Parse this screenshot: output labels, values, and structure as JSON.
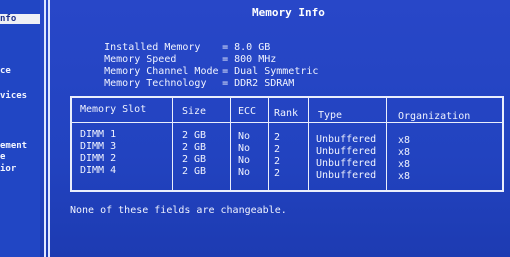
{
  "sidebar": {
    "items": [
      {
        "label": "nfo"
      },
      {
        "label": "ce"
      },
      {
        "label": "vices"
      },
      {
        "label": "ement"
      },
      {
        "label": "e"
      },
      {
        "label": "ior"
      }
    ]
  },
  "page": {
    "title": "Memory Info",
    "info": [
      {
        "label": "Installed Memory",
        "value": "8.0 GB"
      },
      {
        "label": "Memory Speed",
        "value": "800 MHz"
      },
      {
        "label": "Memory Channel Mode",
        "value": "Dual Symmetric"
      },
      {
        "label": "Memory Technology",
        "value": "DDR2 SDRAM"
      }
    ],
    "table": {
      "headers": [
        "Memory Slot",
        "Size",
        "ECC",
        "Rank",
        "Type",
        "Organization"
      ],
      "rows": [
        [
          "DIMM 1",
          "2 GB",
          "No",
          "2",
          "Unbuffered",
          "x8"
        ],
        [
          "DIMM 3",
          "2 GB",
          "No",
          "2",
          "Unbuffered",
          "x8"
        ],
        [
          "DIMM 2",
          "2 GB",
          "No",
          "2",
          "Unbuffered",
          "x8"
        ],
        [
          "DIMM 4",
          "2 GB",
          "No",
          "2",
          "Unbuffered",
          "x8"
        ]
      ]
    },
    "footer": "None of these fields are changeable.",
    "equals_sign": "="
  },
  "colors": {
    "background": "#2243c0",
    "text": "#f0f3ff",
    "selected_bg": "#eef0f5"
  }
}
